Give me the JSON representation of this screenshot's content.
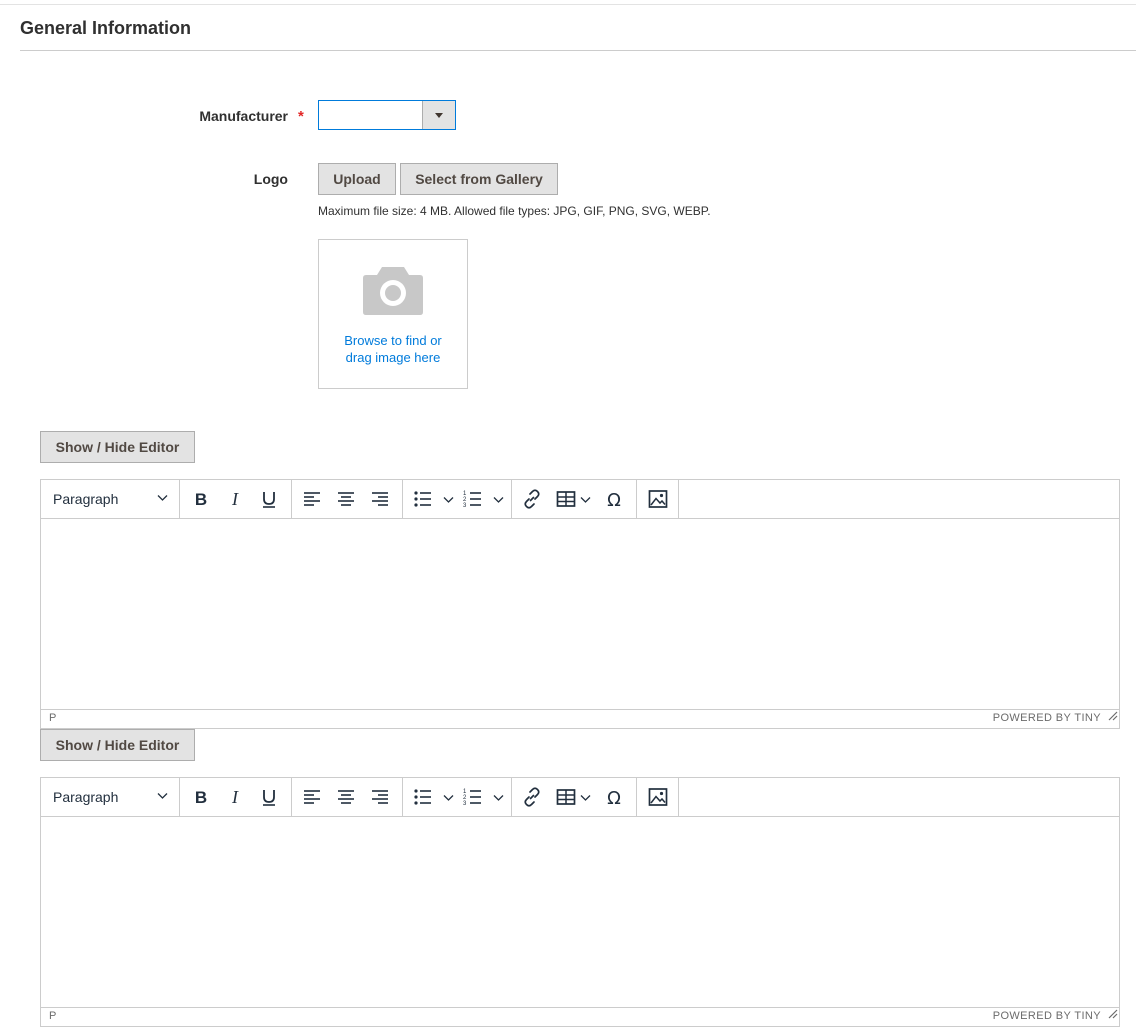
{
  "section": {
    "title": "General Information"
  },
  "manufacturer": {
    "label": "Manufacturer",
    "required_mark": "*",
    "value": ""
  },
  "logo": {
    "label": "Logo",
    "upload_label": "Upload",
    "gallery_label": "Select from Gallery",
    "note": "Maximum file size: 4 MB. Allowed file types: JPG, GIF, PNG, SVG, WEBP.",
    "dropzone_line1": "Browse to find or",
    "dropzone_line2": "drag image here"
  },
  "editors": [
    {
      "toggle_label": "Show / Hide Editor",
      "block_format": "Paragraph",
      "status_path": "P",
      "branding": "POWERED BY TINY"
    },
    {
      "toggle_label": "Show / Hide Editor",
      "block_format": "Paragraph",
      "status_path": "P",
      "branding": "POWERED BY TINY"
    }
  ],
  "colors": {
    "accent": "#007bdb",
    "required": "#e22626",
    "button_bg": "#e3e3e3",
    "icon": "#222f3e"
  },
  "toolbar_icons": [
    "bold-icon",
    "italic-icon",
    "underline-icon",
    "align-left-icon",
    "align-center-icon",
    "align-right-icon",
    "bullet-list-icon",
    "numbered-list-icon",
    "link-icon",
    "table-icon",
    "special-character-icon",
    "image-icon"
  ]
}
